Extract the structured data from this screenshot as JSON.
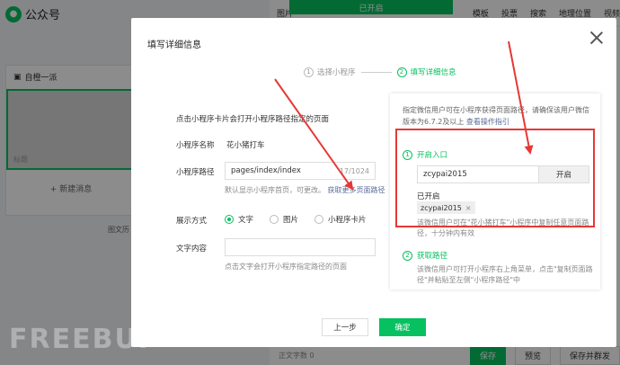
{
  "background": {
    "brand": "公众号",
    "top_status": "已开启",
    "nav": [
      "图片",
      "模板",
      "投票",
      "搜索",
      "地理位置",
      "视频"
    ],
    "article_title": "自橙一派",
    "cover_label": "标题",
    "add_message": "+ 新建消息",
    "aside_label": "图文历",
    "word_count": "正文字数 0",
    "save": "保存",
    "preview": "预览",
    "save_send": "保存并群发",
    "watermark": "FREEBUF"
  },
  "dialog": {
    "title": "填写详细信息",
    "steps": [
      {
        "num": "1",
        "label": "选择小程序"
      },
      {
        "num": "2",
        "label": "填写详细信息"
      }
    ],
    "description": "点击小程序卡片会打开小程序路径指定的页面",
    "mini_name_label": "小程序名称",
    "mini_name_value": "花小猪打车",
    "path_label": "小程序路径",
    "path_value": "pages/index/index",
    "path_count": "17/1024",
    "path_hint": "默认显示小程序首页，可更改。",
    "path_hint_link": "获取更多页面路径",
    "display_label": "展示方式",
    "display_options": [
      "文字",
      "图片",
      "小程序卡片"
    ],
    "text_label": "文字内容",
    "text_hint": "点击文字会打开小程序指定路径的页面",
    "prev": "上一步",
    "confirm": "确定"
  },
  "info": {
    "desc": "指定微信用户可在小程序获得页面路径，请确保该用户微信版本为6.7.2及以上",
    "desc_link": "查看操作指引",
    "sec1_num": "1",
    "sec1_title": "开启入口",
    "user_value": "zcypai2015",
    "open_button": "开启",
    "opened_label": "已开启",
    "tag_value": "zcypai2015",
    "tag_close": "×",
    "sec1_desc": "该微信用户可在\"花小猪打车\"小程序中复制任意页面路径，十分钟内有效",
    "sec2_num": "2",
    "sec2_title": "获取路径",
    "sec2_desc": "该微信用户可打开小程序右上角菜单，点击\"复制页面路径\"并粘贴至左侧\"小程序路径\"中"
  },
  "colors": {
    "accent": "#07c160",
    "annotation": "#e53935",
    "link": "#576b95"
  }
}
